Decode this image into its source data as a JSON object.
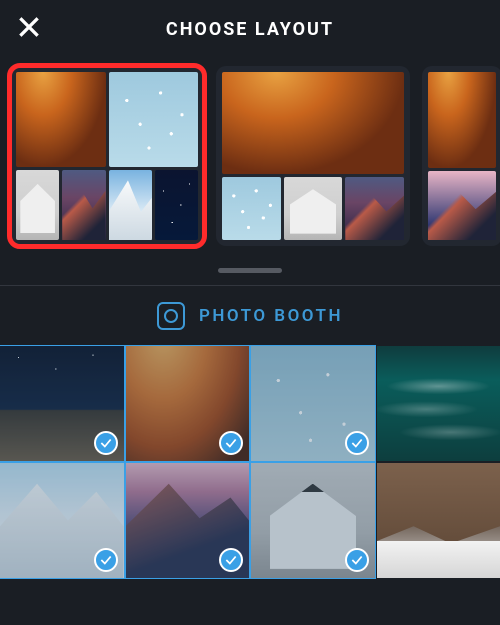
{
  "header": {
    "title": "CHOOSE LAYOUT"
  },
  "actions": {
    "photo_booth_label": "PHOTO BOOTH"
  },
  "layouts": [
    {
      "id": "layout-2x-5tile",
      "selected": true,
      "variant": "v1"
    },
    {
      "id": "layout-1big-3small",
      "selected": false,
      "variant": "v2"
    },
    {
      "id": "layout-stack-2",
      "selected": false,
      "variant": "v3",
      "peek": true
    }
  ],
  "photos": [
    {
      "name": "night-beach-stars",
      "selected": true,
      "thumb": "thumb-starbeach"
    },
    {
      "name": "antelope-canyon",
      "selected": true,
      "thumb": "thumb-canyon"
    },
    {
      "name": "cherry-blossom",
      "selected": true,
      "thumb": "thumb-blossom"
    },
    {
      "name": "ocean-waves",
      "selected": false,
      "thumb": "thumb-ocean"
    },
    {
      "name": "snowy-mountain",
      "selected": true,
      "thumb": "thumb-snowpeak"
    },
    {
      "name": "mountain-sunset",
      "selected": true,
      "thumb": "thumb-mountain-dusk"
    },
    {
      "name": "aframe-house",
      "selected": true,
      "thumb": "thumb-house"
    },
    {
      "name": "rocky-cliff-snow",
      "selected": false,
      "thumb": "thumb-cliff"
    }
  ],
  "colors": {
    "accent": "#3aa0e6",
    "highlight": "#ff2b2b",
    "background": "#1a1e24"
  }
}
